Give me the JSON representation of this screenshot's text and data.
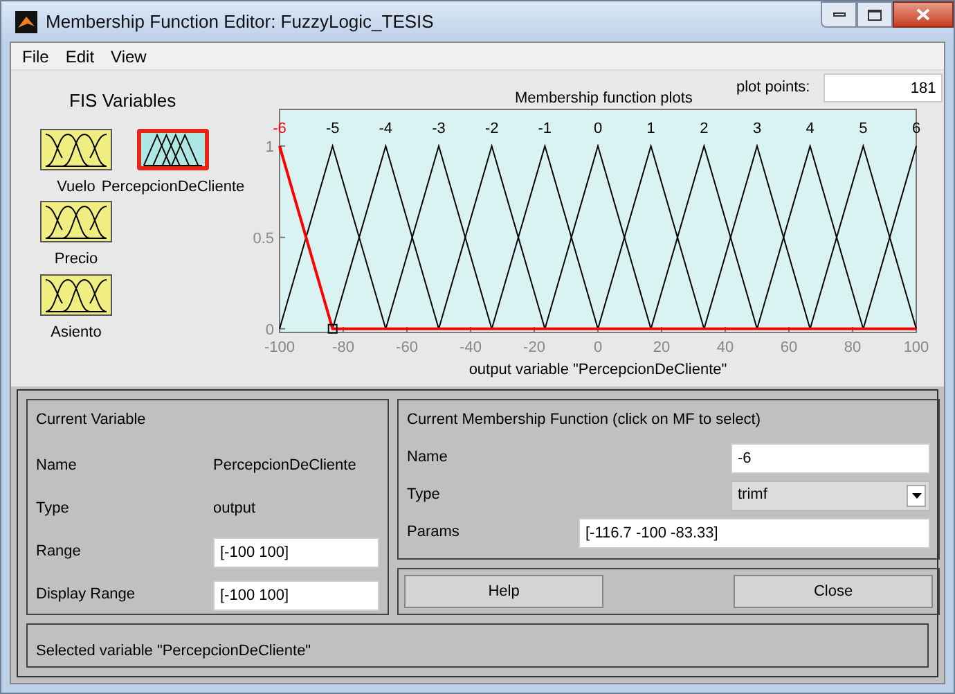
{
  "window": {
    "title": "Membership Function Editor: FuzzyLogic_TESIS"
  },
  "menu": [
    "File",
    "Edit",
    "View"
  ],
  "fis_variables": {
    "title": "FIS Variables",
    "items": [
      {
        "label": "Vuelo",
        "kind": "input",
        "selected": false
      },
      {
        "label": "PercepcionDeCliente",
        "kind": "output",
        "selected": true
      },
      {
        "label": "Precio",
        "kind": "input",
        "selected": false
      },
      {
        "label": "Asiento",
        "kind": "input",
        "selected": false
      }
    ]
  },
  "plot": {
    "plot_points_label": "plot points:",
    "plot_points": "181",
    "chart_data": {
      "type": "line",
      "title": "Membership function plots",
      "xlabel": "output variable \"PercepcionDeCliente\"",
      "x": [
        -100,
        -83.33,
        -66.67,
        -50,
        -33.33,
        -16.67,
        0,
        16.67,
        33.33,
        50,
        66.67,
        83.33,
        100
      ],
      "series": [
        {
          "name": "-6",
          "color": "#ff0000",
          "values": [
            1,
            0,
            0,
            0,
            0,
            0,
            0,
            0,
            0,
            0,
            0,
            0,
            0
          ]
        },
        {
          "name": "-5",
          "color": "#000000",
          "values": [
            0,
            1,
            0,
            null,
            null,
            null,
            null,
            null,
            null,
            null,
            null,
            null,
            null
          ]
        },
        {
          "name": "-4",
          "color": "#000000",
          "values": [
            null,
            0,
            1,
            0,
            null,
            null,
            null,
            null,
            null,
            null,
            null,
            null,
            null
          ]
        },
        {
          "name": "-3",
          "color": "#000000",
          "values": [
            null,
            null,
            0,
            1,
            0,
            null,
            null,
            null,
            null,
            null,
            null,
            null,
            null
          ]
        },
        {
          "name": "-2",
          "color": "#000000",
          "values": [
            null,
            null,
            null,
            0,
            1,
            0,
            null,
            null,
            null,
            null,
            null,
            null,
            null
          ]
        },
        {
          "name": "-1",
          "color": "#000000",
          "values": [
            null,
            null,
            null,
            null,
            0,
            1,
            0,
            null,
            null,
            null,
            null,
            null,
            null
          ]
        },
        {
          "name": "0",
          "color": "#000000",
          "values": [
            null,
            null,
            null,
            null,
            null,
            0,
            1,
            0,
            null,
            null,
            null,
            null,
            null
          ]
        },
        {
          "name": "1",
          "color": "#000000",
          "values": [
            null,
            null,
            null,
            null,
            null,
            null,
            0,
            1,
            0,
            null,
            null,
            null,
            null
          ]
        },
        {
          "name": "2",
          "color": "#000000",
          "values": [
            null,
            null,
            null,
            null,
            null,
            null,
            null,
            0,
            1,
            0,
            null,
            null,
            null
          ]
        },
        {
          "name": "3",
          "color": "#000000",
          "values": [
            null,
            null,
            null,
            null,
            null,
            null,
            null,
            null,
            0,
            1,
            0,
            null,
            null
          ]
        },
        {
          "name": "4",
          "color": "#000000",
          "values": [
            null,
            null,
            null,
            null,
            null,
            null,
            null,
            null,
            null,
            0,
            1,
            0,
            null
          ]
        },
        {
          "name": "5",
          "color": "#000000",
          "values": [
            null,
            null,
            null,
            null,
            null,
            null,
            null,
            null,
            null,
            null,
            0,
            1,
            0
          ]
        },
        {
          "name": "6",
          "color": "#000000",
          "values": [
            null,
            null,
            null,
            null,
            null,
            null,
            null,
            null,
            null,
            null,
            null,
            0,
            1
          ]
        }
      ],
      "xlim": [
        -100,
        100
      ],
      "ylim": [
        -0.02,
        1.2
      ],
      "xticks": [
        -100,
        -80,
        -60,
        -40,
        -20,
        0,
        20,
        40,
        60,
        80,
        100
      ],
      "yticks": [
        0,
        0.5,
        1
      ]
    }
  },
  "current_variable": {
    "title": "Current Variable",
    "fields": [
      {
        "label": "Name",
        "value": "PercepcionDeCliente",
        "kind": "text"
      },
      {
        "label": "Type",
        "value": "output",
        "kind": "text"
      },
      {
        "label": "Range",
        "value": "[-100 100]",
        "kind": "input"
      },
      {
        "label": "Display Range",
        "value": "[-100 100]",
        "kind": "input"
      }
    ]
  },
  "current_mf": {
    "title": "Current Membership Function (click on MF to select)",
    "fields": [
      {
        "label": "Name",
        "value": "-6",
        "kind": "input"
      },
      {
        "label": "Type",
        "value": "trimf",
        "kind": "dropdown"
      },
      {
        "label": "Params",
        "value": "[-116.7 -100 -83.33]",
        "kind": "wide"
      }
    ]
  },
  "buttons": [
    "Help",
    "Close"
  ],
  "status_bar": "Selected variable \"PercepcionDeCliente\""
}
